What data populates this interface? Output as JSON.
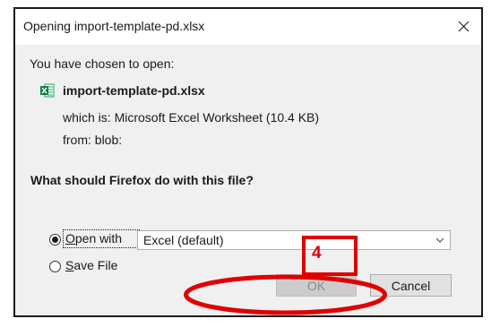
{
  "dialog": {
    "title": "Opening import-template-pd.xlsx",
    "close_icon": "close-icon",
    "chosen_text": "You have chosen to open:",
    "file": {
      "name": "import-template-pd.xlsx",
      "icon": "excel-file-icon",
      "which_is": "which is: Microsoft Excel Worksheet (10.4 KB)",
      "from": "from: blob:"
    },
    "question": "What should Firefox do with this file?",
    "options": {
      "open_with_label": "Open with",
      "open_with_selected": true,
      "app_select_value": "Excel (default)",
      "save_file_label": "Save File",
      "save_file_selected": false
    },
    "buttons": {
      "ok_label": "OK",
      "cancel_label": "Cancel"
    }
  },
  "annotation": {
    "step_number": "4",
    "color": "#e00000"
  }
}
